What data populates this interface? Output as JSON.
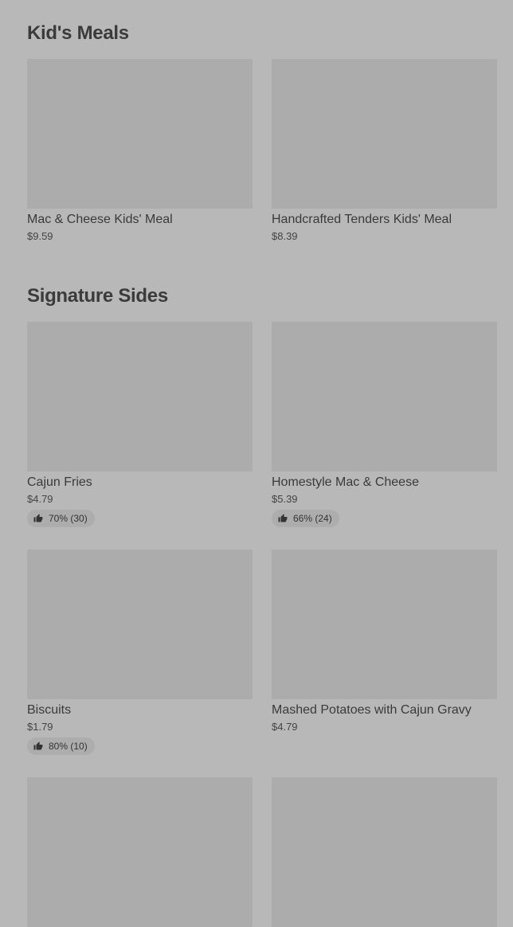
{
  "sections": [
    {
      "title": "Kid's Meals",
      "items": [
        {
          "name": "Mac & Cheese Kids' Meal",
          "price": "$9.59"
        },
        {
          "name": "Handcrafted Tenders Kids' Meal",
          "price": "$8.39"
        }
      ]
    },
    {
      "title": "Signature Sides",
      "items": [
        {
          "name": "Cajun Fries",
          "price": "$4.79",
          "rating": "70% (30)"
        },
        {
          "name": "Homestyle Mac & Cheese",
          "price": "$5.39",
          "rating": "66% (24)"
        },
        {
          "name": "Biscuits",
          "price": "$1.79",
          "rating": "80% (10)"
        },
        {
          "name": "Mashed Potatoes with Cajun Gravy",
          "price": "$4.79"
        }
      ]
    }
  ],
  "icons": {
    "rating": "thumbs-up-icon"
  },
  "colors": {
    "background": "#b8b8b8",
    "image_placeholder": "#acacac",
    "badge": "#adadad",
    "text": "#3a3a3a"
  }
}
